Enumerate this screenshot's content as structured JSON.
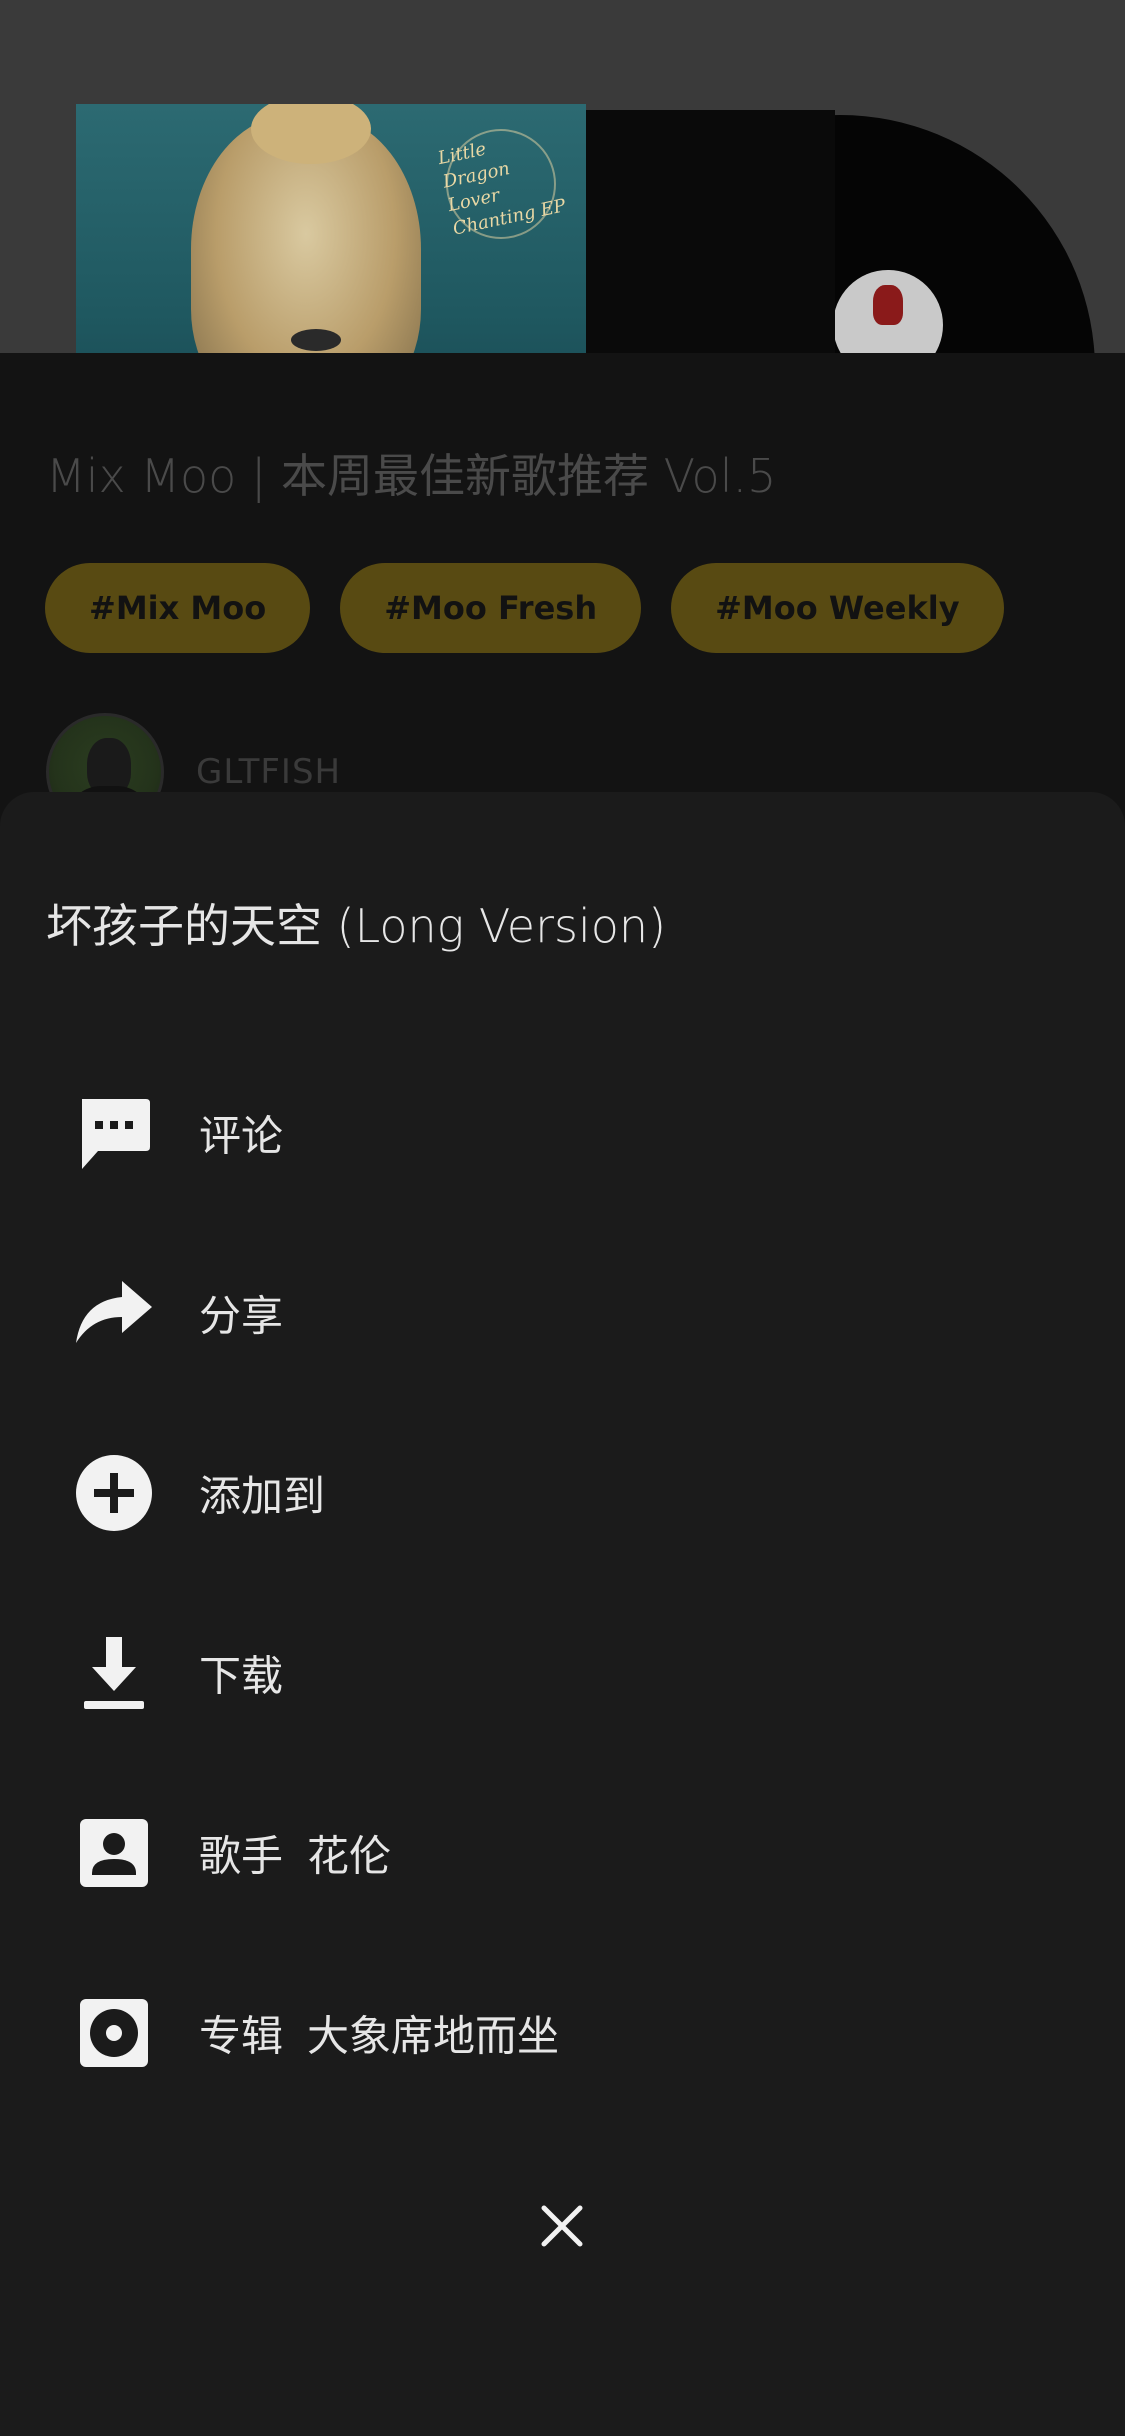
{
  "background": {
    "album_cover": {
      "script_text": "Little Dragon Lover Chanting EP"
    },
    "playlist_title": "Mix Moo | 本周最佳新歌推荐 Vol.5",
    "tags": [
      "#Mix Moo",
      "#Moo Fresh",
      "#Moo Weekly"
    ],
    "creator_name": "GLTFISH"
  },
  "sheet": {
    "song_title": "坏孩子的天空 (Long Version)",
    "items": [
      {
        "id": "comment",
        "label": "评论",
        "sub": "",
        "icon": "comment-icon"
      },
      {
        "id": "share",
        "label": "分享",
        "sub": "",
        "icon": "share-icon"
      },
      {
        "id": "add-to",
        "label": "添加到",
        "sub": "",
        "icon": "add-circle-icon"
      },
      {
        "id": "download",
        "label": "下载",
        "sub": "",
        "icon": "download-icon"
      },
      {
        "id": "artist",
        "label": "歌手",
        "sub": "花伦",
        "icon": "artist-icon"
      },
      {
        "id": "album",
        "label": "专辑",
        "sub": "大象席地而坐",
        "icon": "album-icon"
      }
    ],
    "close_icon": "close-icon"
  },
  "colors": {
    "sheet_background": "#1b1b1b",
    "text_primary": "#e6e6e6",
    "tag_background": "#584a12",
    "overlay_dim": "#131313"
  }
}
